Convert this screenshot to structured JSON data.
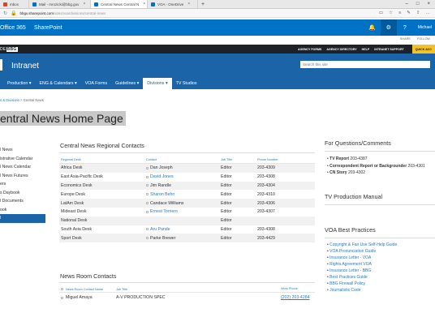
{
  "browser": {
    "tabs": [
      {
        "label": "mbox",
        "active": false,
        "color": "#d24726"
      },
      {
        "label": "Mail - mrozicki@bbg.gov",
        "active": false,
        "color": "#0072c6"
      },
      {
        "label": "Central News Central N",
        "active": true,
        "color": "#0072c6"
      },
      {
        "label": "VOA - OneDrive",
        "active": false,
        "color": "#0072c6"
      }
    ],
    "new_tab": "+",
    "url_host": "bbgv.sharepoint.com",
    "url_path": "/sites/voa/divisions/central-news"
  },
  "o365": {
    "brand": "Office 365",
    "app": "SharePoint",
    "user": "Michael"
  },
  "suite2": {
    "share": "SHARE",
    "follow": "FOLLOW"
  },
  "site": {
    "logo_prefix": "DE",
    "logo_badge": "BBG",
    "links": [
      "AGENCY FORMS",
      "AGENCY DIRECTORY",
      "HELP",
      "INTRANET SUPPORT"
    ],
    "quick": "QUICK ACC",
    "title": "Intranet",
    "search_placeholder": "Search this site"
  },
  "nav": [
    "Production",
    "ENG & Calendars",
    "VOA Forms",
    "Guidelines",
    "Divisions",
    "TV Studios"
  ],
  "nav_active": "Divisions",
  "breadcrumb": {
    "parent": "s & Divisions",
    "sep": ">",
    "current": "Central News"
  },
  "page_title": "entral News Home Page",
  "leftnav": [
    "l News",
    "istrative Calendar",
    "l News Calendar",
    "l News Futures",
    "ers",
    "s Daybook",
    "l Documents",
    "ook",
    "l"
  ],
  "contacts": {
    "title": "Central News Regional Contacts",
    "headers": [
      "Regional Desk",
      "Contact",
      "Job Title",
      "Phone Number"
    ],
    "rows": [
      {
        "desk": "Africa Desk",
        "contact": "Dan Joseph",
        "link": false,
        "job": "Editor",
        "phone": "203-4309"
      },
      {
        "desk": "East Asia-Pacific Desk",
        "contact": "David Jones",
        "link": true,
        "job": "Editor",
        "phone": "203-4308"
      },
      {
        "desk": "Economics Desk",
        "contact": "Jim Randle",
        "link": false,
        "job": "Editor",
        "phone": "203-4304"
      },
      {
        "desk": "Europe Desk",
        "contact": "Sharon Behn",
        "link": true,
        "job": "Editor",
        "phone": "203-4310"
      },
      {
        "desk": "LatAm Desk",
        "contact": "Candace Williams",
        "link": false,
        "job": "Editor",
        "phone": "203-4306"
      },
      {
        "desk": "Mideast Desk",
        "contact": "Ernest Torriero",
        "link": true,
        "job": "Editor",
        "phone": "203-4307"
      },
      {
        "desk": "National Desk",
        "contact": "",
        "link": false,
        "job": "Editor",
        "phone": ""
      },
      {
        "desk": "South Asia Desk",
        "contact": "Aru Pande",
        "link": true,
        "job": "Editor",
        "phone": "203-4308"
      },
      {
        "desk": "Sport Desk",
        "contact": "Parke Brewer",
        "link": false,
        "job": "Editor",
        "phone": "203-4429"
      }
    ]
  },
  "newsroom": {
    "title": "News Room Contacts",
    "headers": [
      "News Room Contact Name",
      "Job Title",
      "Work Phone"
    ],
    "rows": [
      {
        "name": "Miguel Amaya",
        "job": "A-V PRODUCTION SPEC",
        "phone": "(202) 203-4284"
      }
    ]
  },
  "questions": {
    "title": "For Questions/Comments",
    "items": [
      {
        "label": "TV Report",
        "value": "203-4387"
      },
      {
        "label": "Correspondent Report or Backgrounder",
        "value": "203-4301"
      },
      {
        "label": "CN Story",
        "value": "203-4302"
      }
    ]
  },
  "tv_manual": {
    "title": "TV Production Manual"
  },
  "best_practices": {
    "title": "VOA Best Practices",
    "links": [
      "Copyright & Fair Use Self-Help Guide",
      "VOA Pronunciation Guide",
      "Insurance Letter - VOA",
      "Rights Agreement VOA",
      "Insurance Letter - BBG",
      "Best Practices Guide",
      "BBG Firewall Policy",
      "Journalistic Code"
    ]
  },
  "colors": {
    "o365_blue": "#0072c6",
    "site_blue": "#1b64a7",
    "link_blue": "#2b79c2",
    "quick_yellow": "#f2c22b"
  }
}
